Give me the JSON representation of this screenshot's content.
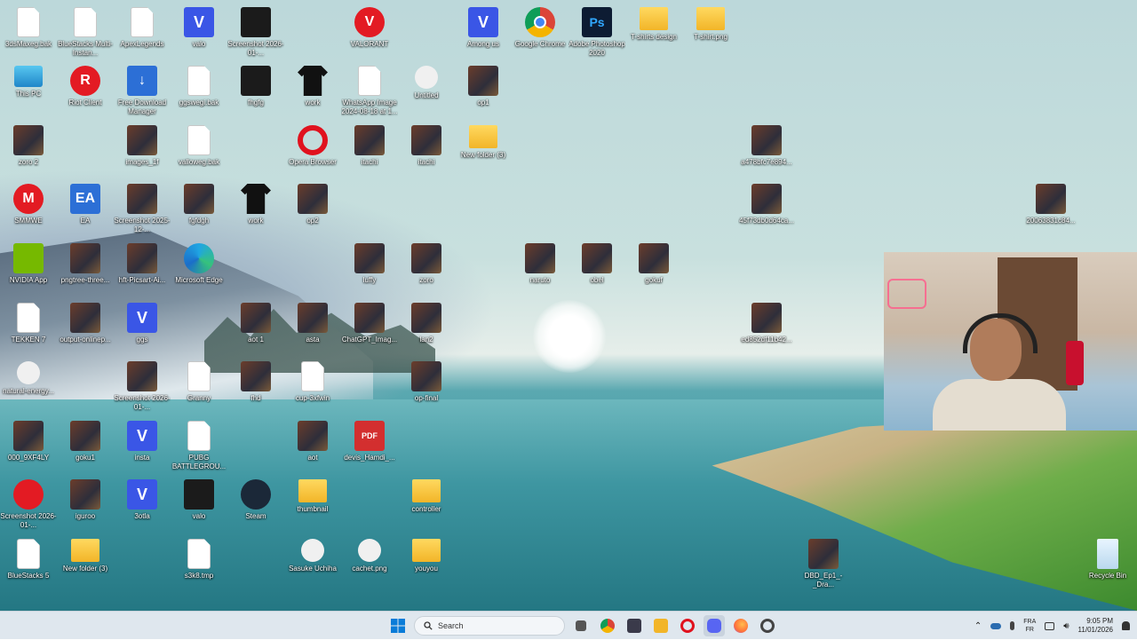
{
  "desktop_icons": [
    {
      "label": "3dsMaxeg.bak",
      "glyph": "doc",
      "text": ""
    },
    {
      "label": "BlueStacks Multi-Instan...",
      "glyph": "doc",
      "text": ""
    },
    {
      "label": "ApexLegends",
      "glyph": "doc",
      "text": ""
    },
    {
      "label": "valo",
      "glyph": "v",
      "text": "V"
    },
    {
      "label": "Screenshot 2026-01-...",
      "glyph": "dark",
      "text": ""
    },
    {
      "label": "VALORANT",
      "glyph": "red",
      "text": "V"
    },
    {
      "label": "Among us",
      "glyph": "v",
      "text": "V"
    },
    {
      "label": "Google Chrome",
      "glyph": "chrome",
      "text": ""
    },
    {
      "label": "Adobe Photoshop 2020",
      "glyph": "ps",
      "text": "Ps"
    },
    {
      "label": "T-shirts design",
      "glyph": "folder",
      "text": ""
    },
    {
      "label": "T-shirt.png",
      "glyph": "folder",
      "text": ""
    },
    {
      "label": "This PC",
      "glyph": "pc",
      "text": ""
    },
    {
      "label": "Riot Client",
      "glyph": "red",
      "text": "R"
    },
    {
      "label": "Free Download Manager",
      "glyph": "blue",
      "text": "↓"
    },
    {
      "label": "ggswegi.bak",
      "glyph": "doc",
      "text": ""
    },
    {
      "label": "fhgfg",
      "glyph": "dark",
      "text": ""
    },
    {
      "label": "work",
      "glyph": "shirt",
      "text": ""
    },
    {
      "label": "WhatsApp Image 2024-08-18 at 1...",
      "glyph": "doc",
      "text": ""
    },
    {
      "label": "Untitled",
      "glyph": "small",
      "text": ""
    },
    {
      "label": "op1",
      "glyph": "photo",
      "text": ""
    },
    {
      "label": "zoro 2",
      "glyph": "photo",
      "text": ""
    },
    {
      "label": "images_1f",
      "glyph": "photo",
      "text": ""
    },
    {
      "label": "valloweg.bak",
      "glyph": "doc",
      "text": ""
    },
    {
      "label": "Opera Browser",
      "glyph": "opera",
      "text": ""
    },
    {
      "label": "itachi",
      "glyph": "photo",
      "text": ""
    },
    {
      "label": "itachi",
      "glyph": "photo",
      "text": ""
    },
    {
      "label": "New folder (3)",
      "glyph": "folder",
      "text": ""
    },
    {
      "label": "a478bfc7e894...",
      "glyph": "photo",
      "text": ""
    },
    {
      "label": "SMMWE",
      "glyph": "red",
      "text": "M"
    },
    {
      "label": "EA",
      "glyph": "blue",
      "text": "EA"
    },
    {
      "label": "Screenshot 2025-12-...",
      "glyph": "photo",
      "text": ""
    },
    {
      "label": "fgfdgh",
      "glyph": "photo",
      "text": ""
    },
    {
      "label": "work",
      "glyph": "shirt",
      "text": ""
    },
    {
      "label": "op2",
      "glyph": "photo",
      "text": ""
    },
    {
      "label": "45f73db0d64ca...",
      "glyph": "photo",
      "text": ""
    },
    {
      "label": "20063831c84...",
      "glyph": "photo",
      "text": ""
    },
    {
      "label": "NVIDIA App",
      "glyph": "nvidia",
      "text": ""
    },
    {
      "label": "pngtree-three...",
      "glyph": "photo",
      "text": ""
    },
    {
      "label": "hft-Picsart-Ai...",
      "glyph": "photo",
      "text": ""
    },
    {
      "label": "Microsoft Edge",
      "glyph": "edge",
      "text": ""
    },
    {
      "label": "luffy",
      "glyph": "photo",
      "text": ""
    },
    {
      "label": "zoro",
      "glyph": "photo",
      "text": ""
    },
    {
      "label": "naruto",
      "glyph": "photo",
      "text": ""
    },
    {
      "label": "obel",
      "glyph": "photo",
      "text": ""
    },
    {
      "label": "gokuf",
      "glyph": "photo",
      "text": ""
    },
    {
      "label": "TEKKEN 7",
      "glyph": "doc",
      "text": ""
    },
    {
      "label": "output-onlinep...",
      "glyph": "photo",
      "text": ""
    },
    {
      "label": "ggs",
      "glyph": "v",
      "text": "V"
    },
    {
      "label": "aot 1",
      "glyph": "photo",
      "text": ""
    },
    {
      "label": "asta",
      "glyph": "photo",
      "text": ""
    },
    {
      "label": "ChatGPT_Imag...",
      "glyph": "photo",
      "text": ""
    },
    {
      "label": "lan2",
      "glyph": "photo",
      "text": ""
    },
    {
      "label": "ed852df11b42...",
      "glyph": "photo",
      "text": ""
    },
    {
      "label": "natural-energy...",
      "glyph": "small",
      "text": ""
    },
    {
      "label": "Screenshot 2026-01-...",
      "glyph": "photo",
      "text": ""
    },
    {
      "label": "Granny",
      "glyph": "doc",
      "text": ""
    },
    {
      "label": "fhd",
      "glyph": "photo",
      "text": ""
    },
    {
      "label": "cup-3xfwin",
      "glyph": "doc",
      "text": ""
    },
    {
      "label": "op-final",
      "glyph": "photo",
      "text": ""
    },
    {
      "label": "000_9XF4LY",
      "glyph": "photo",
      "text": ""
    },
    {
      "label": "goku1",
      "glyph": "photo",
      "text": ""
    },
    {
      "label": "insta",
      "glyph": "v",
      "text": "V"
    },
    {
      "label": "PUBG BATTLEGROU...",
      "glyph": "doc",
      "text": ""
    },
    {
      "label": "aot",
      "glyph": "photo",
      "text": ""
    },
    {
      "label": "devis_Hamdi_...",
      "glyph": "pdf",
      "text": "PDF"
    },
    {
      "label": "Screenshot 2026-01-...",
      "glyph": "red",
      "text": ""
    },
    {
      "label": "iguroo",
      "glyph": "photo",
      "text": ""
    },
    {
      "label": "3otla",
      "glyph": "v",
      "text": "V"
    },
    {
      "label": "valo",
      "glyph": "dark",
      "text": ""
    },
    {
      "label": "Steam",
      "glyph": "steam",
      "text": ""
    },
    {
      "label": "thumbnail",
      "glyph": "folder",
      "text": ""
    },
    {
      "label": "controller",
      "glyph": "folder",
      "text": ""
    },
    {
      "label": "BlueStacks 5",
      "glyph": "doc",
      "text": ""
    },
    {
      "label": "New folder (3)",
      "glyph": "folder",
      "text": ""
    },
    {
      "label": "s3k8.tmp",
      "glyph": "doc",
      "text": ""
    },
    {
      "label": "Sasuke Uchiha",
      "glyph": "small",
      "text": ""
    },
    {
      "label": "cachet.png",
      "glyph": "small",
      "text": ""
    },
    {
      "label": "youyou",
      "glyph": "folder",
      "text": ""
    },
    {
      "label": "DBD_Ep1_-_Dra...",
      "glyph": "photo",
      "text": ""
    },
    {
      "label": "Recycle Bin",
      "glyph": "bin",
      "text": ""
    }
  ],
  "taskbar": {
    "search_placeholder": "Search",
    "apps": [
      "start-icon",
      "search",
      "task-view-icon",
      "chrome-icon",
      "snipping-icon",
      "file-explorer-icon",
      "opera-icon",
      "discord-icon",
      "firefox-icon",
      "settings-icon"
    ],
    "lang_top": "FRA",
    "lang_bottom": "FR",
    "time": "9:05 PM",
    "date": "11/01/2026"
  },
  "colors": {
    "taskbar": "#dfe7ee",
    "accent": "#0067c0"
  }
}
